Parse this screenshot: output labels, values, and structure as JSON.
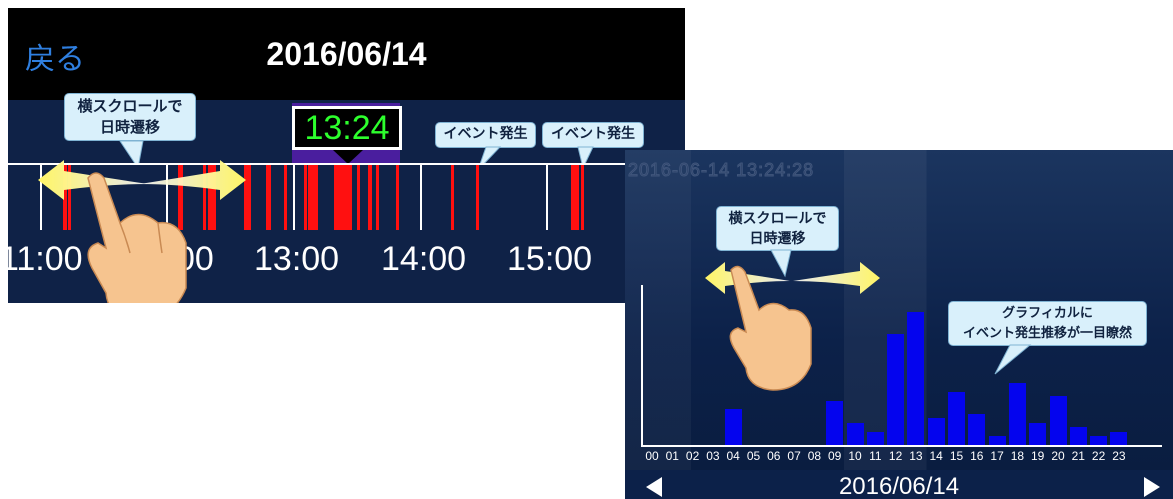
{
  "timeline_screen": {
    "back_label": "戻る",
    "date": "2016/06/14",
    "current_time": "13:24",
    "ticks": [
      "11:00",
      "00",
      "13:00",
      "14:00",
      "15:00"
    ],
    "scroll_hint": [
      "横スクロールで",
      "日時遷移"
    ],
    "event_label_1": "イベント発生",
    "event_label_2": "イベント発生",
    "event_color": "#ff1010",
    "time_color": "#2dff2d"
  },
  "chart_screen": {
    "timestamp": "2016-06-14 13:24:28",
    "scroll_hint": [
      "横スクロールで",
      "日時遷移"
    ],
    "annotation": [
      "グラフィカルに",
      "イベント発生推移が一目瞭然"
    ],
    "date": "2016/06/14",
    "prev_icon": "triangle-left-icon",
    "next_icon": "triangle-right-icon",
    "bar_color": "#0404ee"
  },
  "chart_data": {
    "type": "bar",
    "categories": [
      "00",
      "01",
      "02",
      "03",
      "04",
      "05",
      "06",
      "07",
      "08",
      "09",
      "10",
      "11",
      "12",
      "13",
      "14",
      "15",
      "16",
      "17",
      "18",
      "19",
      "20",
      "21",
      "22",
      "23"
    ],
    "series": [
      {
        "values": [
          0,
          0,
          0,
          0,
          4,
          0,
          0,
          0,
          0,
          5,
          2.5,
          1.5,
          12.5,
          15,
          3,
          6,
          3.5,
          1,
          7,
          2.5,
          5.5,
          2,
          1,
          1.5
        ]
      }
    ],
    "ylim": [
      0,
      18
    ],
    "grid": false
  }
}
